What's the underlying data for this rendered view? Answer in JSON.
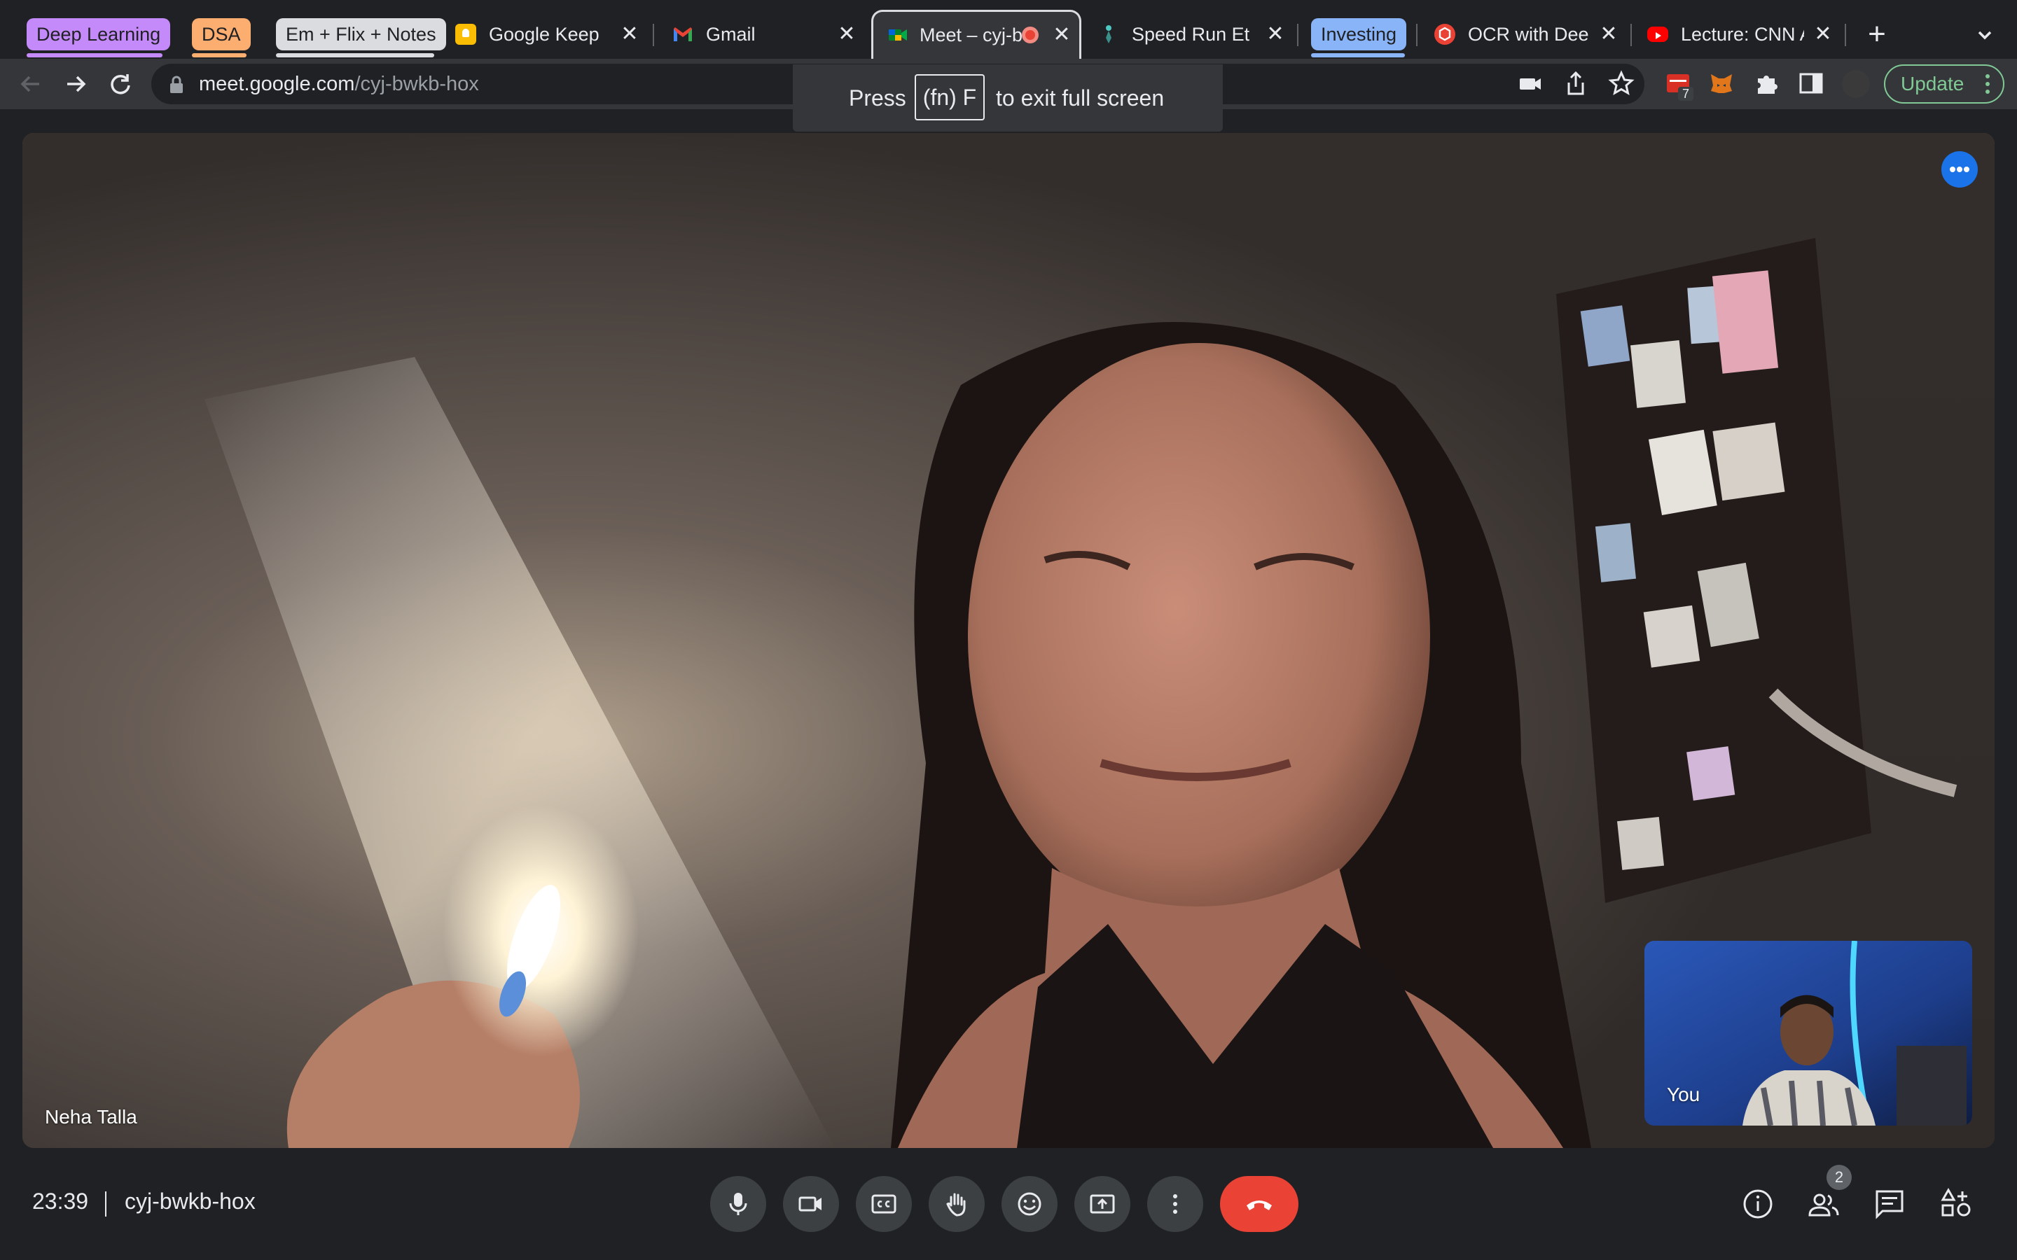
{
  "browser": {
    "tab_groups": [
      {
        "label": "Deep Learning",
        "color": "#c58af9"
      },
      {
        "label": "DSA",
        "color": "#fcad70"
      },
      {
        "label": "Em + Flix + Notes",
        "color": "#dadce0"
      },
      {
        "label": "Investing",
        "color": "#8ab4f8"
      }
    ],
    "tabs": [
      {
        "title": "Google Keep",
        "icon": "keep-icon"
      },
      {
        "title": "Gmail",
        "icon": "gmail-icon"
      },
      {
        "title": "Meet – cyj-bwkb-hox",
        "icon": "meet-icon",
        "active": true
      },
      {
        "title": "Speed Run Ethereum",
        "icon": "ethereum-icon"
      },
      {
        "title": "OCR with Deep Learning",
        "icon": "hexagon-icon"
      },
      {
        "title": "Lecture: CNN Architectures",
        "icon": "youtube-icon"
      }
    ],
    "new_tab_symbol": "+",
    "url_host": "meet.google.com",
    "url_path": "/cyj-bwkb-hox",
    "update_label": "Update",
    "extension_badge": "7"
  },
  "fullscreen_toast": {
    "press": "Press",
    "key": "(fn) F",
    "rest": "to exit full screen"
  },
  "meeting": {
    "main_participant": "Neha Talla",
    "self_label": "You",
    "time": "23:39",
    "meeting_code": "cyj-bwkb-hox",
    "participants_count": "2"
  }
}
